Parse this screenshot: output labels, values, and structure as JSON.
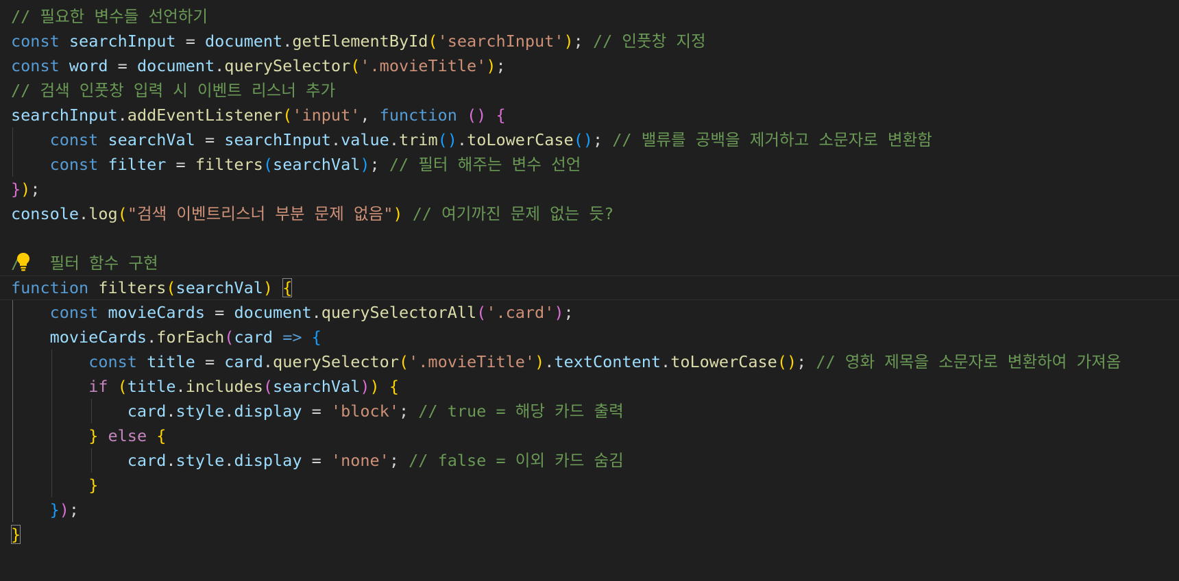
{
  "editor": {
    "language": "javascript",
    "theme_colors": {
      "background": "#1f1f1f",
      "keyword": "#569cd6",
      "variable": "#9cdcfe",
      "function": "#dcdcaa",
      "string": "#ce9178",
      "comment": "#6a9955",
      "punctuation": "#d4d4d4",
      "bracket_level1": "#ffd700",
      "bracket_level2": "#da70d6",
      "bracket_level3": "#179fff",
      "control": "#c586c0"
    },
    "lightbulb_icon": "lightbulb-icon",
    "lines": [
      {
        "tokens": [
          {
            "t": "c",
            "text": "// 필요한 변수들 선언하기"
          }
        ]
      },
      {
        "tokens": [
          {
            "t": "k",
            "text": "const"
          },
          {
            "t": "p",
            "text": " "
          },
          {
            "t": "v",
            "text": "searchInput"
          },
          {
            "t": "p",
            "text": " = "
          },
          {
            "t": "v",
            "text": "document"
          },
          {
            "t": "p",
            "text": "."
          },
          {
            "t": "f",
            "text": "getElementById"
          },
          {
            "t": "b1",
            "text": "("
          },
          {
            "t": "s",
            "text": "'searchInput'"
          },
          {
            "t": "b1",
            "text": ")"
          },
          {
            "t": "p",
            "text": "; "
          },
          {
            "t": "c",
            "text": "// 인풋창 지정"
          }
        ]
      },
      {
        "tokens": [
          {
            "t": "k",
            "text": "const"
          },
          {
            "t": "p",
            "text": " "
          },
          {
            "t": "v",
            "text": "word"
          },
          {
            "t": "p",
            "text": " = "
          },
          {
            "t": "v",
            "text": "document"
          },
          {
            "t": "p",
            "text": "."
          },
          {
            "t": "f",
            "text": "querySelector"
          },
          {
            "t": "b1",
            "text": "("
          },
          {
            "t": "s",
            "text": "'.movieTitle'"
          },
          {
            "t": "b1",
            "text": ")"
          },
          {
            "t": "p",
            "text": ";"
          }
        ]
      },
      {
        "tokens": [
          {
            "t": "c",
            "text": "// 검색 인풋창 입력 시 이벤트 리스너 추가"
          }
        ]
      },
      {
        "tokens": [
          {
            "t": "v",
            "text": "searchInput"
          },
          {
            "t": "p",
            "text": "."
          },
          {
            "t": "f",
            "text": "addEventListener"
          },
          {
            "t": "b1",
            "text": "("
          },
          {
            "t": "s",
            "text": "'input'"
          },
          {
            "t": "p",
            "text": ", "
          },
          {
            "t": "k",
            "text": "function"
          },
          {
            "t": "p",
            "text": " "
          },
          {
            "t": "b2",
            "text": "()"
          },
          {
            "t": "p",
            "text": " "
          },
          {
            "t": "b2",
            "text": "{"
          }
        ]
      },
      {
        "tokens": [
          {
            "t": "p",
            "text": "    "
          },
          {
            "t": "k",
            "text": "const"
          },
          {
            "t": "p",
            "text": " "
          },
          {
            "t": "v",
            "text": "searchVal"
          },
          {
            "t": "p",
            "text": " = "
          },
          {
            "t": "v",
            "text": "searchInput"
          },
          {
            "t": "p",
            "text": "."
          },
          {
            "t": "v",
            "text": "value"
          },
          {
            "t": "p",
            "text": "."
          },
          {
            "t": "f",
            "text": "trim"
          },
          {
            "t": "b3",
            "text": "()"
          },
          {
            "t": "p",
            "text": "."
          },
          {
            "t": "f",
            "text": "toLowerCase"
          },
          {
            "t": "b3",
            "text": "()"
          },
          {
            "t": "p",
            "text": "; "
          },
          {
            "t": "c",
            "text": "// 밸류를 공백을 제거하고 소문자로 변환함"
          }
        ]
      },
      {
        "tokens": [
          {
            "t": "p",
            "text": "    "
          },
          {
            "t": "k",
            "text": "const"
          },
          {
            "t": "p",
            "text": " "
          },
          {
            "t": "v",
            "text": "filter"
          },
          {
            "t": "p",
            "text": " = "
          },
          {
            "t": "f",
            "text": "filters"
          },
          {
            "t": "b3",
            "text": "("
          },
          {
            "t": "v",
            "text": "searchVal"
          },
          {
            "t": "b3",
            "text": ")"
          },
          {
            "t": "p",
            "text": "; "
          },
          {
            "t": "c",
            "text": "// 필터 해주는 변수 선언"
          }
        ]
      },
      {
        "tokens": [
          {
            "t": "b2",
            "text": "}"
          },
          {
            "t": "b1",
            "text": ")"
          },
          {
            "t": "p",
            "text": ";"
          }
        ]
      },
      {
        "tokens": [
          {
            "t": "v",
            "text": "console"
          },
          {
            "t": "p",
            "text": "."
          },
          {
            "t": "f",
            "text": "log"
          },
          {
            "t": "b1",
            "text": "("
          },
          {
            "t": "s",
            "text": "\"검색 이벤트리스너 부분 문제 없음\""
          },
          {
            "t": "b1",
            "text": ")"
          },
          {
            "t": "p",
            "text": " "
          },
          {
            "t": "c",
            "text": "// 여기까진 문제 없는 듯?"
          }
        ]
      },
      {
        "tokens": []
      },
      {
        "tokens": [
          {
            "t": "c",
            "text": "/   필터 함수 구현"
          }
        ]
      },
      {
        "tokens": [
          {
            "t": "k",
            "text": "function"
          },
          {
            "t": "p",
            "text": " "
          },
          {
            "t": "f",
            "text": "filters"
          },
          {
            "t": "b1",
            "text": "("
          },
          {
            "t": "v",
            "text": "searchVal"
          },
          {
            "t": "b1",
            "text": ")"
          },
          {
            "t": "p",
            "text": " "
          },
          {
            "t": "b1",
            "text": "{",
            "box": true
          }
        ]
      },
      {
        "tokens": [
          {
            "t": "p",
            "text": "    "
          },
          {
            "t": "k",
            "text": "const"
          },
          {
            "t": "p",
            "text": " "
          },
          {
            "t": "v",
            "text": "movieCards"
          },
          {
            "t": "p",
            "text": " = "
          },
          {
            "t": "v",
            "text": "document"
          },
          {
            "t": "p",
            "text": "."
          },
          {
            "t": "f",
            "text": "querySelectorAll"
          },
          {
            "t": "b2",
            "text": "("
          },
          {
            "t": "s",
            "text": "'.card'"
          },
          {
            "t": "b2",
            "text": ")"
          },
          {
            "t": "p",
            "text": ";"
          }
        ]
      },
      {
        "tokens": [
          {
            "t": "p",
            "text": "    "
          },
          {
            "t": "v",
            "text": "movieCards"
          },
          {
            "t": "p",
            "text": "."
          },
          {
            "t": "f",
            "text": "forEach"
          },
          {
            "t": "b2",
            "text": "("
          },
          {
            "t": "v",
            "text": "card"
          },
          {
            "t": "p",
            "text": " "
          },
          {
            "t": "k",
            "text": "=>"
          },
          {
            "t": "p",
            "text": " "
          },
          {
            "t": "b3",
            "text": "{"
          }
        ]
      },
      {
        "tokens": [
          {
            "t": "p",
            "text": "        "
          },
          {
            "t": "k",
            "text": "const"
          },
          {
            "t": "p",
            "text": " "
          },
          {
            "t": "v",
            "text": "title"
          },
          {
            "t": "p",
            "text": " = "
          },
          {
            "t": "v",
            "text": "card"
          },
          {
            "t": "p",
            "text": "."
          },
          {
            "t": "f",
            "text": "querySelector"
          },
          {
            "t": "b1",
            "text": "("
          },
          {
            "t": "s",
            "text": "'.movieTitle'"
          },
          {
            "t": "b1",
            "text": ")"
          },
          {
            "t": "p",
            "text": "."
          },
          {
            "t": "v",
            "text": "textContent"
          },
          {
            "t": "p",
            "text": "."
          },
          {
            "t": "f",
            "text": "toLowerCase"
          },
          {
            "t": "b1",
            "text": "()"
          },
          {
            "t": "p",
            "text": "; "
          },
          {
            "t": "c",
            "text": "// 영화 제목을 소문자로 변환하여 가져옴"
          }
        ]
      },
      {
        "tokens": [
          {
            "t": "p",
            "text": "        "
          },
          {
            "t": "ctl",
            "text": "if"
          },
          {
            "t": "p",
            "text": " "
          },
          {
            "t": "b1",
            "text": "("
          },
          {
            "t": "v",
            "text": "title"
          },
          {
            "t": "p",
            "text": "."
          },
          {
            "t": "f",
            "text": "includes"
          },
          {
            "t": "b2",
            "text": "("
          },
          {
            "t": "v",
            "text": "searchVal"
          },
          {
            "t": "b2",
            "text": ")"
          },
          {
            "t": "b1",
            "text": ")"
          },
          {
            "t": "p",
            "text": " "
          },
          {
            "t": "b1",
            "text": "{"
          }
        ]
      },
      {
        "tokens": [
          {
            "t": "p",
            "text": "            "
          },
          {
            "t": "v",
            "text": "card"
          },
          {
            "t": "p",
            "text": "."
          },
          {
            "t": "v",
            "text": "style"
          },
          {
            "t": "p",
            "text": "."
          },
          {
            "t": "v",
            "text": "display"
          },
          {
            "t": "p",
            "text": " = "
          },
          {
            "t": "s",
            "text": "'block'"
          },
          {
            "t": "p",
            "text": "; "
          },
          {
            "t": "c",
            "text": "// true = 해당 카드 출력"
          }
        ]
      },
      {
        "tokens": [
          {
            "t": "p",
            "text": "        "
          },
          {
            "t": "b1",
            "text": "}"
          },
          {
            "t": "p",
            "text": " "
          },
          {
            "t": "ctl",
            "text": "else"
          },
          {
            "t": "p",
            "text": " "
          },
          {
            "t": "b1",
            "text": "{"
          }
        ]
      },
      {
        "tokens": [
          {
            "t": "p",
            "text": "            "
          },
          {
            "t": "v",
            "text": "card"
          },
          {
            "t": "p",
            "text": "."
          },
          {
            "t": "v",
            "text": "style"
          },
          {
            "t": "p",
            "text": "."
          },
          {
            "t": "v",
            "text": "display"
          },
          {
            "t": "p",
            "text": " = "
          },
          {
            "t": "s",
            "text": "'none'"
          },
          {
            "t": "p",
            "text": "; "
          },
          {
            "t": "c",
            "text": "// false = 이외 카드 숨김"
          }
        ]
      },
      {
        "tokens": [
          {
            "t": "p",
            "text": "        "
          },
          {
            "t": "b1",
            "text": "}"
          }
        ]
      },
      {
        "tokens": [
          {
            "t": "p",
            "text": "    "
          },
          {
            "t": "b3",
            "text": "}"
          },
          {
            "t": "b2",
            "text": ")"
          },
          {
            "t": "p",
            "text": ";"
          }
        ]
      },
      {
        "tokens": [
          {
            "t": "b1",
            "text": "}",
            "box": true
          }
        ]
      }
    ]
  }
}
